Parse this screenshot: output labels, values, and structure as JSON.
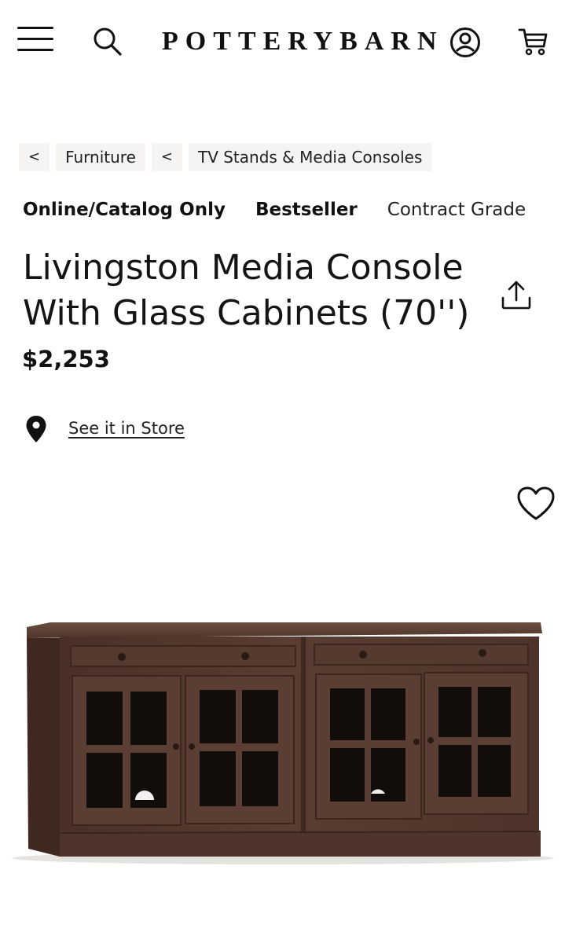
{
  "header": {
    "logo_text": "POTTERYBARN",
    "icons": [
      "menu-icon",
      "search-icon",
      "account-icon",
      "cart-icon"
    ]
  },
  "breadcrumb": {
    "back_symbol": "<",
    "items": [
      {
        "label": "Furniture"
      },
      {
        "label": "TV Stands & Media Consoles"
      }
    ]
  },
  "badges": [
    {
      "label": "Online/Catalog Only"
    },
    {
      "label": "Bestseller"
    },
    {
      "label": "Contract Grade"
    }
  ],
  "product": {
    "title_line1": "Livingston Media Console",
    "title_line2": "With Glass Cabinets (70'')",
    "price": "$2,253",
    "store_link": "See it in Store"
  },
  "colors": {
    "text": "#111111",
    "breadcrumb_bg": "#f5f4f2",
    "wood_dark": "#4a3128",
    "wood_mid": "#5e4034"
  }
}
